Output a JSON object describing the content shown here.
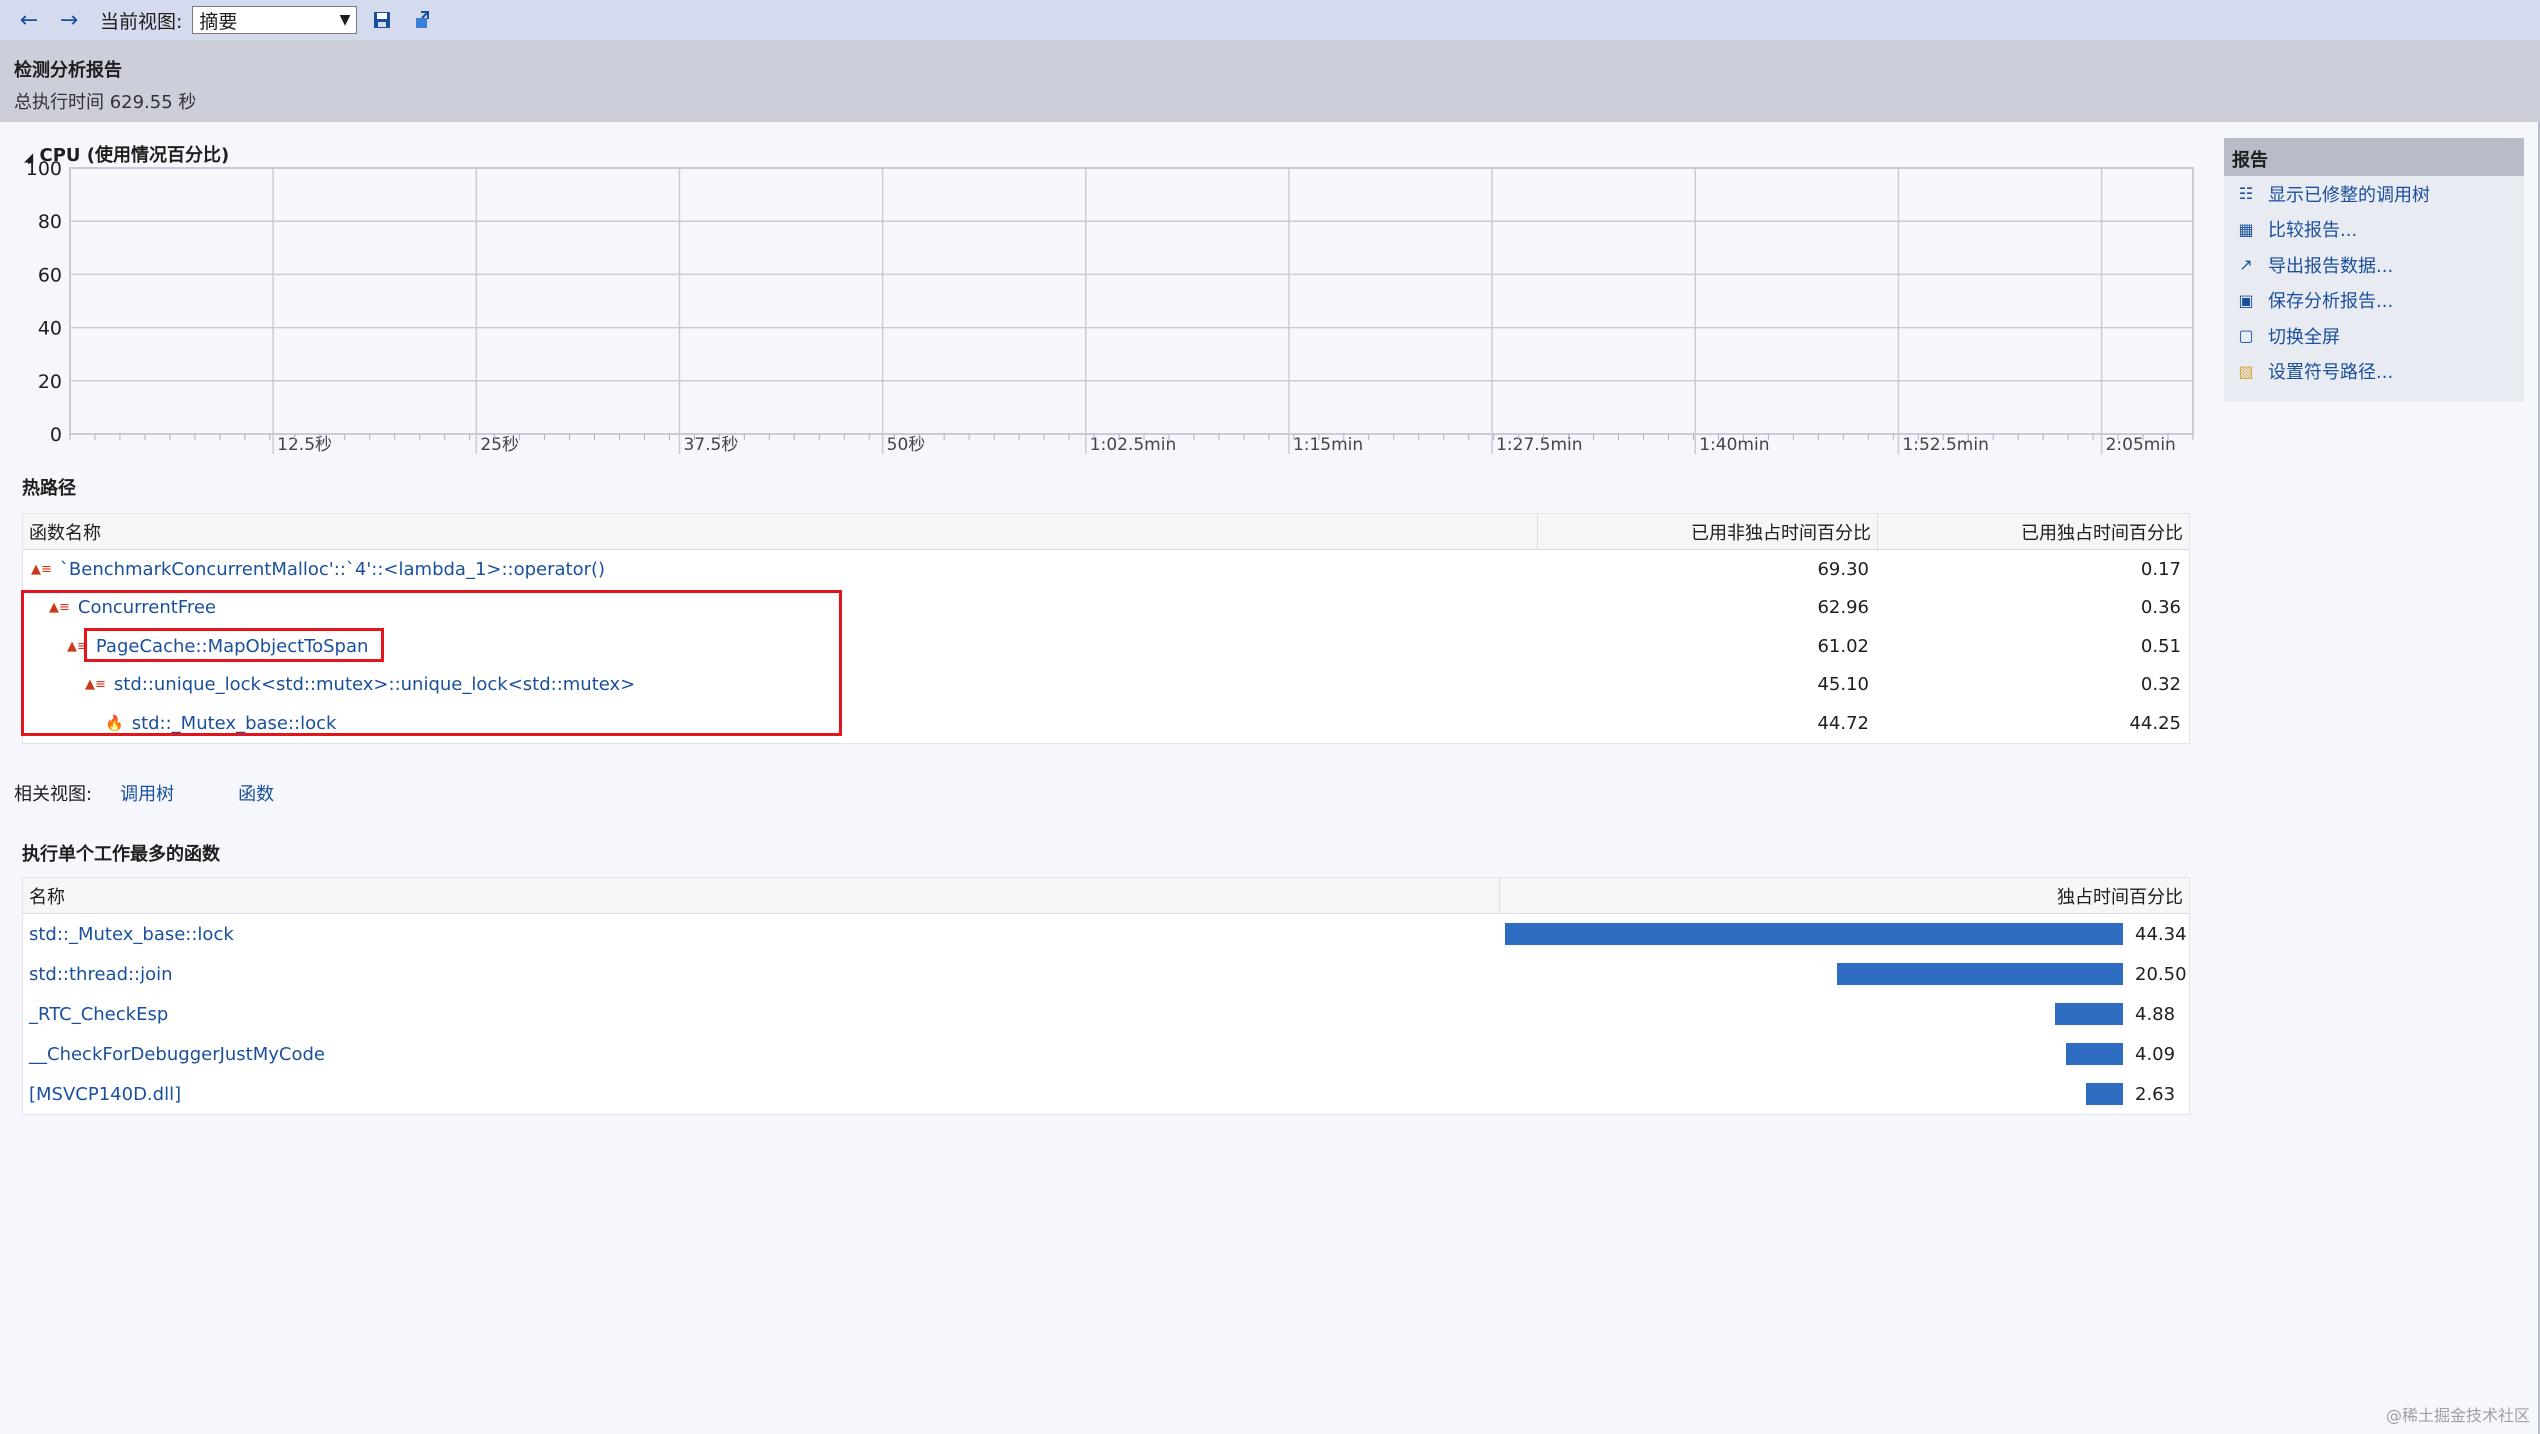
{
  "toolbar": {
    "current_view_label": "当前视图:",
    "view_value": "摘要"
  },
  "header": {
    "title": "检测分析报告",
    "subtitle": "总执行时间 629.55 秒"
  },
  "cpu_section": {
    "title": "CPU (使用情况百分比)"
  },
  "chart_data": {
    "type": "line",
    "title": "CPU (使用情况百分比)",
    "y_ticks": [
      "100",
      "80",
      "60",
      "40",
      "20",
      "0"
    ],
    "ylim": [
      0,
      100
    ],
    "x_ticks": [
      "12.5秒",
      "25秒",
      "37.5秒",
      "50秒",
      "1:02.5min",
      "1:15min",
      "1:27.5min",
      "1:40min",
      "1:52.5min",
      "2:05min"
    ],
    "grid": true,
    "series": []
  },
  "hot_path": {
    "title": "热路径",
    "columns": [
      "函数名称",
      "已用非独占时间百分比",
      "已用独占时间百分比"
    ],
    "rows": [
      {
        "name": "`BenchmarkConcurrentMalloc'::`4'::<lambda_1>::operator()",
        "inclusive": "69.30",
        "exclusive": "0.17"
      },
      {
        "name": "ConcurrentFree",
        "inclusive": "62.96",
        "exclusive": "0.36"
      },
      {
        "name": "PageCache::MapObjectToSpan",
        "inclusive": "61.02",
        "exclusive": "0.51"
      },
      {
        "name": "std::unique_lock<std::mutex>::unique_lock<std::mutex>",
        "inclusive": "45.10",
        "exclusive": "0.32"
      },
      {
        "name": "std::_Mutex_base::lock",
        "inclusive": "44.72",
        "exclusive": "44.25"
      }
    ]
  },
  "related": {
    "label": "相关视图:",
    "call_tree": "调用树",
    "functions": "函数"
  },
  "top_work": {
    "title": "执行单个工作最多的函数",
    "columns": [
      "名称",
      "独占时间百分比"
    ],
    "max_value": 44.34,
    "rows": [
      {
        "name": "std::_Mutex_base::lock",
        "value": 44.34,
        "label": "44.34"
      },
      {
        "name": "std::thread::join",
        "value": 20.5,
        "label": "20.50"
      },
      {
        "name": "_RTC_CheckEsp",
        "value": 4.88,
        "label": "4.88"
      },
      {
        "name": "__CheckForDebuggerJustMyCode",
        "value": 4.09,
        "label": "4.09"
      },
      {
        "name": "[MSVCP140D.dll]",
        "value": 2.63,
        "label": "2.63"
      }
    ]
  },
  "report": {
    "title": "报告",
    "items": [
      {
        "label": "显示已修整的调用树",
        "icon": "call-tree-icon"
      },
      {
        "label": "比较报告...",
        "icon": "compare-icon"
      },
      {
        "label": "导出报告数据...",
        "icon": "export-icon"
      },
      {
        "label": "保存分析报告...",
        "icon": "save-icon"
      },
      {
        "label": "切换全屏",
        "icon": "fullscreen-icon"
      },
      {
        "label": "设置符号路径...",
        "icon": "folder-icon"
      }
    ]
  },
  "watermark": "@稀土掘金技术社区"
}
